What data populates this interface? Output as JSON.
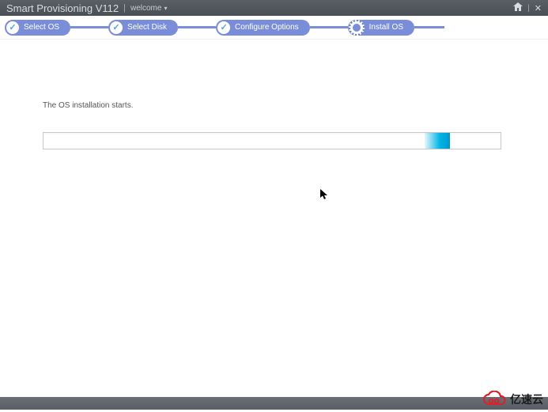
{
  "header": {
    "app_title": "Smart Provisioning V112",
    "welcome_label": "welcome"
  },
  "stepper": {
    "steps": [
      {
        "label": "Select OS",
        "done": true
      },
      {
        "label": "Select Disk",
        "done": true
      },
      {
        "label": "Configure Options",
        "done": true
      },
      {
        "label": "Install OS",
        "active": true
      }
    ]
  },
  "main": {
    "status_text": "The OS installation starts."
  },
  "watermark": {
    "text": "亿速云"
  }
}
